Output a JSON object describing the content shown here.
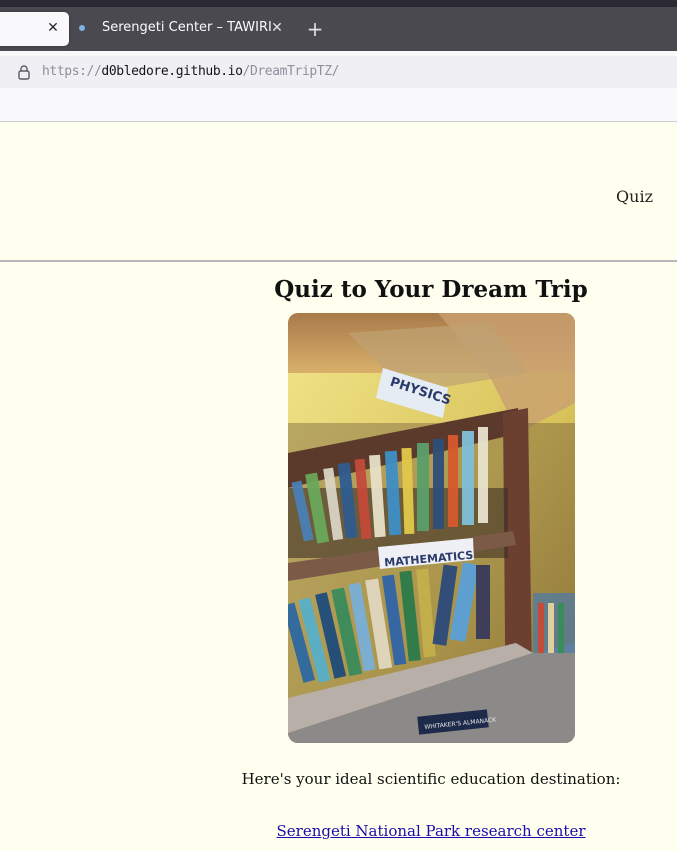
{
  "browser": {
    "tab_title": "Serengeti Center – TAWIRI",
    "url_scheme": "https://",
    "url_host": "d0bledore.github.io",
    "url_path": "/DreamTripTZ/"
  },
  "site": {
    "nav_quiz": "Quiz"
  },
  "page": {
    "heading": "Quiz to Your Dream Trip",
    "image_labels": [
      "PHYSICS",
      "MATHEMATICS",
      "WHITAKER'S ALMANACK"
    ],
    "result_text": "Here's your ideal scientific education destination:",
    "result_link": "Serengeti National Park research center"
  },
  "colors": {
    "page_bg": "#fffff0",
    "link": "#1a0dab",
    "tabbar": "#4a4950"
  }
}
